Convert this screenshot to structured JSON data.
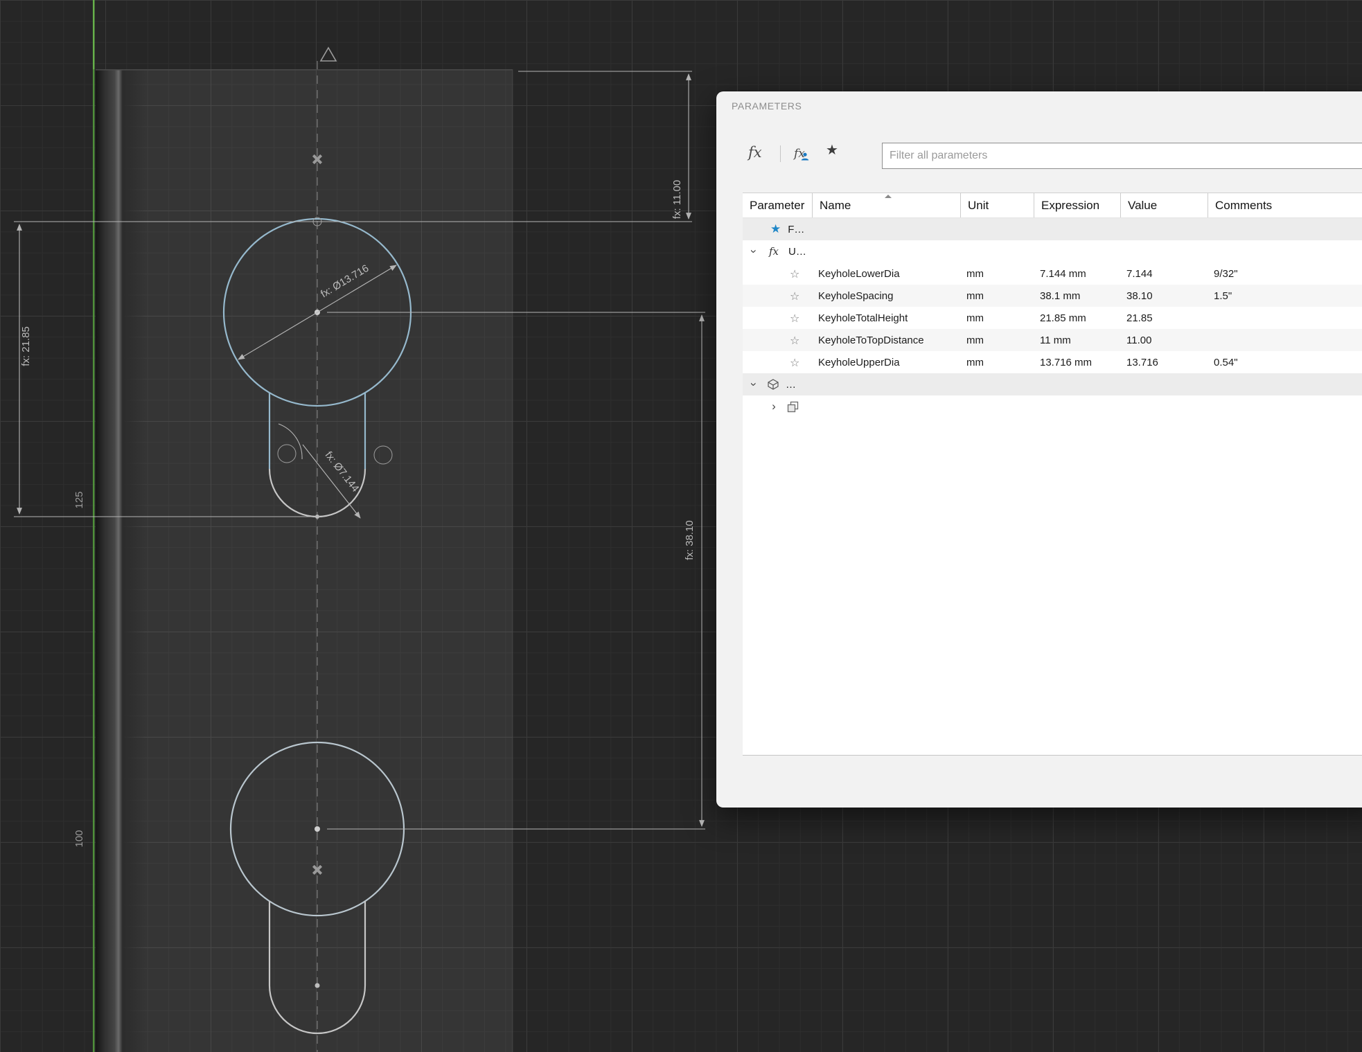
{
  "canvas": {
    "dimensions": {
      "keyhole_to_top": "fx: 11.00",
      "keyhole_spacing": "fx: 38.10",
      "keyhole_total_height": "fx: 21.85",
      "upper_dia": "fx: Ø13.716",
      "lower_dia": "fx: Ø7.144",
      "grid_label_125": "125",
      "grid_label_100": "100"
    }
  },
  "dialog": {
    "title": "PARAMETERS",
    "filter_placeholder": "Filter all parameters",
    "table": {
      "headers": [
        "Parameter",
        "Name",
        "Unit",
        "Expression",
        "Value",
        "Comments"
      ],
      "groups": {
        "favorites_label": "F…",
        "user_label": "U…",
        "model_label": "…"
      },
      "rows": [
        {
          "name": "KeyholeLowerDia",
          "unit": "mm",
          "expression": "7.144 mm",
          "value": "7.144",
          "comments": "9/32\""
        },
        {
          "name": "KeyholeSpacing",
          "unit": "mm",
          "expression": "38.1 mm",
          "value": "38.10",
          "comments": "1.5\""
        },
        {
          "name": "KeyholeTotalHeight",
          "unit": "mm",
          "expression": "21.85 mm",
          "value": "21.85",
          "comments": ""
        },
        {
          "name": "KeyholeToTopDistance",
          "unit": "mm",
          "expression": "11 mm",
          "value": "11.00",
          "comments": ""
        },
        {
          "name": "KeyholeUpperDia",
          "unit": "mm",
          "expression": "13.716 mm",
          "value": "13.716",
          "comments": "0.54\""
        }
      ]
    }
  },
  "icons": {
    "toolbar": [
      "fx-icon",
      "fx-user-icon",
      "star-icon"
    ],
    "rows": [
      "favorites-star-icon",
      "chevron-down-icon",
      "chevron-right-icon",
      "fx-icon",
      "model-cube-icon",
      "component-icon"
    ]
  },
  "colors": {
    "accent_blue": "#1f86c7",
    "sketch_blue": "#96b9cd",
    "axis_green": "#5a9a3f",
    "canvas_bg": "#262626",
    "dialog_bg": "#f2f2f2",
    "dim_text": "#bdbdbd"
  }
}
